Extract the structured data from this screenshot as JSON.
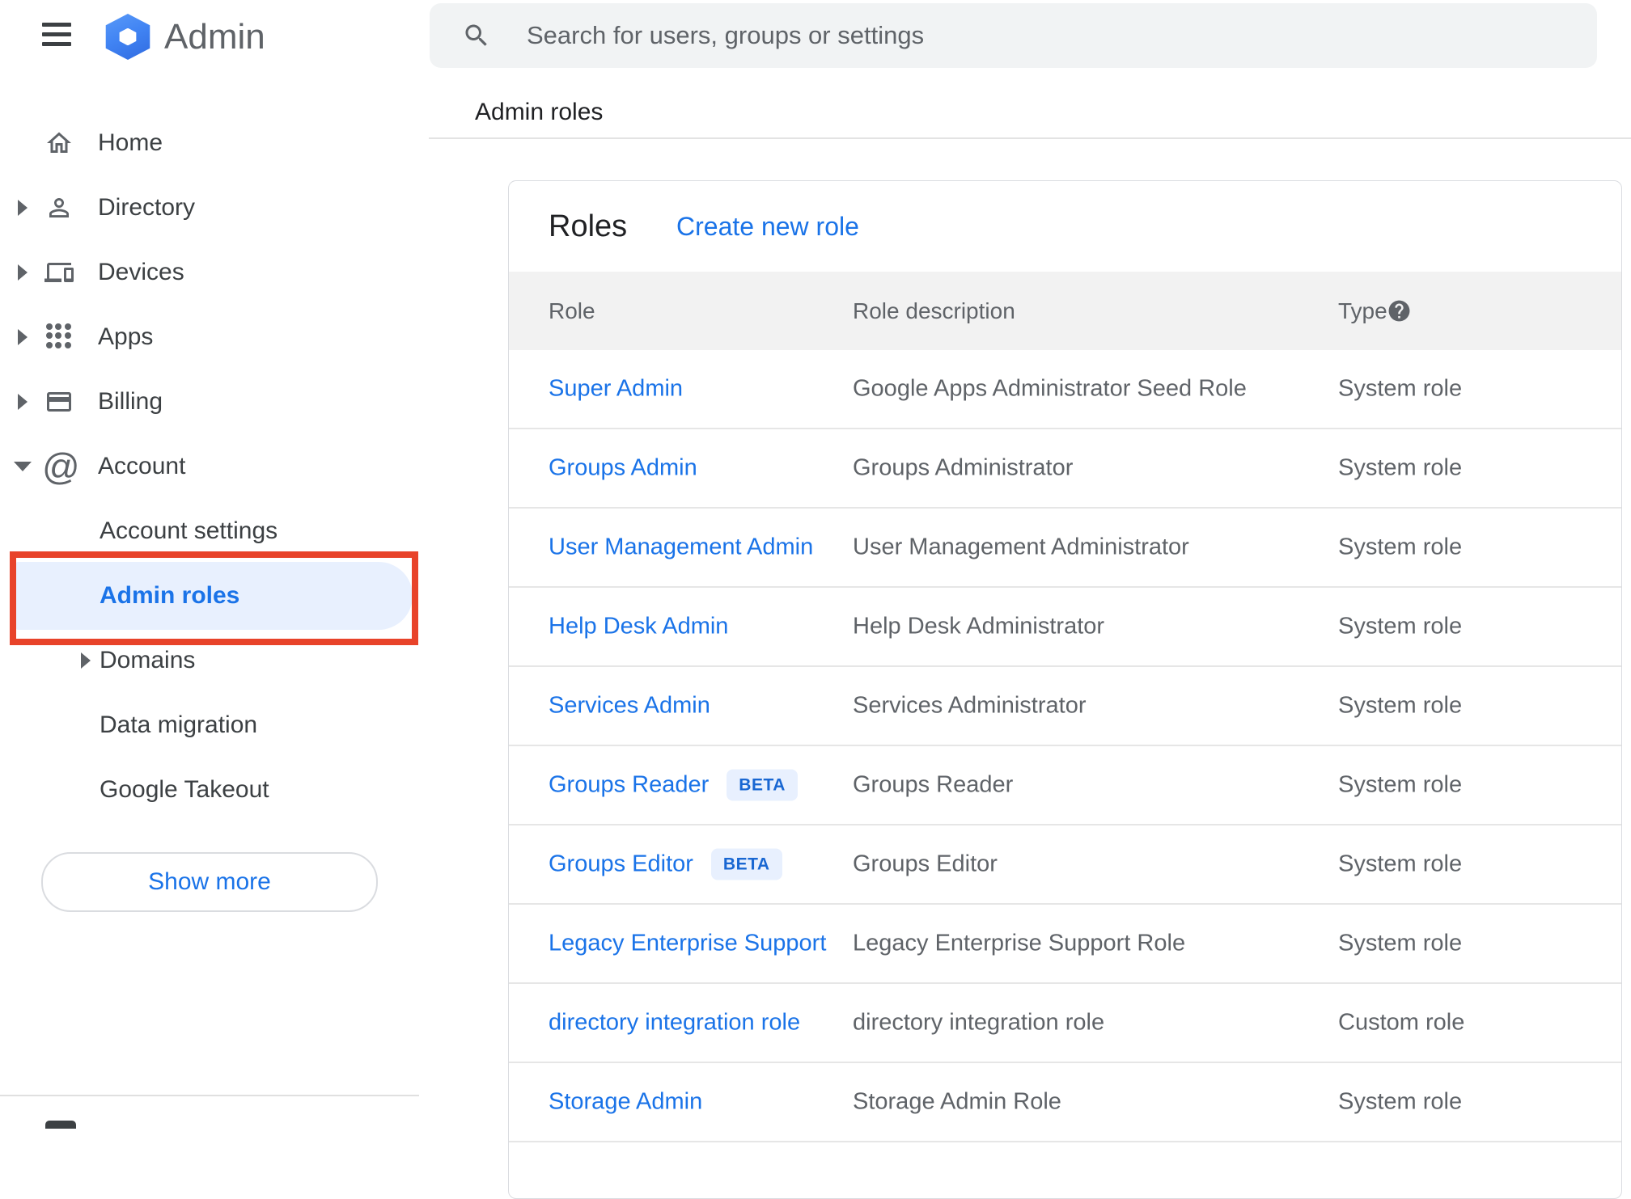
{
  "topbar": {
    "product_name": "Admin",
    "search_placeholder": "Search for users, groups or settings"
  },
  "breadcrumb": "Admin roles",
  "sidebar": {
    "items": [
      {
        "label": "Home"
      },
      {
        "label": "Directory",
        "expandable": true
      },
      {
        "label": "Devices",
        "expandable": true
      },
      {
        "label": "Apps",
        "expandable": true
      },
      {
        "label": "Billing",
        "expandable": true
      },
      {
        "label": "Account",
        "expandable": true,
        "expanded": true
      },
      {
        "label": "Account settings"
      },
      {
        "label": "Admin roles",
        "active": true,
        "annotated": true
      },
      {
        "label": "Domains",
        "expandable": true
      },
      {
        "label": "Data migration"
      },
      {
        "label": "Google Takeout"
      }
    ],
    "show_more_label": "Show more"
  },
  "roles_card": {
    "title": "Roles",
    "create_link": "Create new role",
    "columns": {
      "role": "Role",
      "description": "Role description",
      "type": "Type"
    },
    "rows": [
      {
        "role": "Super Admin",
        "description": "Google Apps Administrator Seed Role",
        "type": "System role"
      },
      {
        "role": "Groups Admin",
        "description": "Groups Administrator",
        "type": "System role"
      },
      {
        "role": "User Management Admin",
        "description": "User Management Administrator",
        "type": "System role"
      },
      {
        "role": "Help Desk Admin",
        "description": "Help Desk Administrator",
        "type": "System role"
      },
      {
        "role": "Services Admin",
        "description": "Services Administrator",
        "type": "System role"
      },
      {
        "role": "Groups Reader",
        "badge": "BETA",
        "description": "Groups Reader",
        "type": "System role"
      },
      {
        "role": "Groups Editor",
        "badge": "BETA",
        "description": "Groups Editor",
        "type": "System role"
      },
      {
        "role": "Legacy Enterprise Support",
        "description": "Legacy Enterprise Support Role",
        "type": "System role"
      },
      {
        "role": "directory integration role",
        "description": "directory integration role",
        "type": "Custom role"
      },
      {
        "role": "Storage Admin",
        "description": "Storage Admin Role",
        "type": "System role"
      }
    ]
  },
  "colors": {
    "accent_blue": "#1a73e8",
    "beta_text_blue": "#1967d2",
    "highlight_blue_bg": "#e8f0fe",
    "annotation_red": "#e8432a",
    "icon_gray": "#5f6368",
    "text_dark": "#202124",
    "table_header_bg": "#f2f2f2"
  }
}
